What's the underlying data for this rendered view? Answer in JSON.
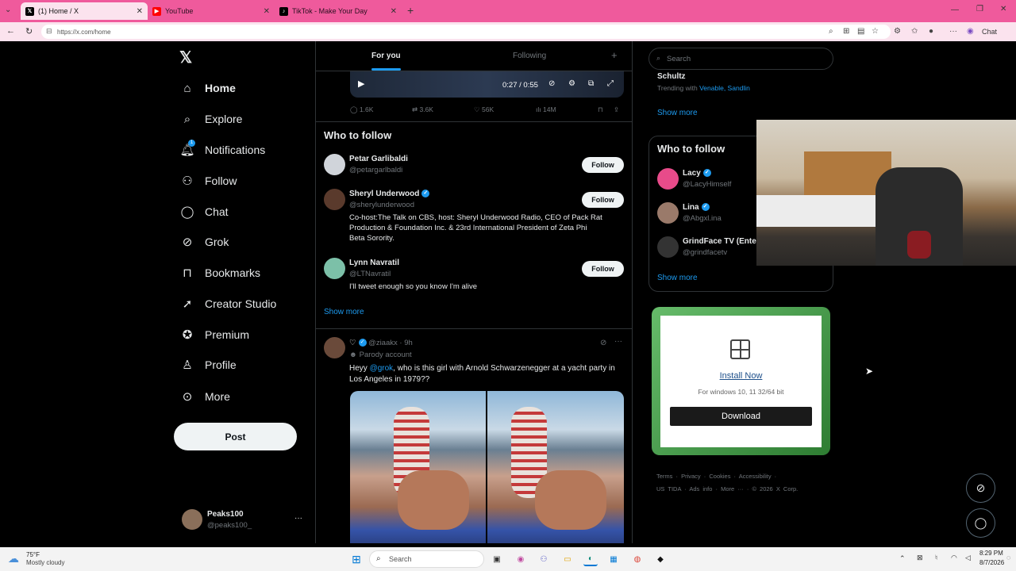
{
  "browser": {
    "tabs": [
      {
        "label": "(1) Home / X"
      },
      {
        "label": "YouTube"
      },
      {
        "label": "TikTok - Make Your Day"
      }
    ],
    "url": "https://x.com/home",
    "chat_label": "Chat"
  },
  "nav": {
    "items": [
      {
        "label": "Home",
        "icon": "home-icon"
      },
      {
        "label": "Explore",
        "icon": "search-icon"
      },
      {
        "label": "Notifications",
        "icon": "bell-icon"
      },
      {
        "label": "Follow",
        "icon": "add-person-icon"
      },
      {
        "label": "Chat",
        "icon": "chat-bubble-icon"
      },
      {
        "label": "Grok",
        "icon": "grok-icon"
      },
      {
        "label": "Bookmarks",
        "icon": "bookmark-icon"
      },
      {
        "label": "Creator Studio",
        "icon": "rocket-icon"
      },
      {
        "label": "Premium",
        "icon": "verified-badge-icon"
      },
      {
        "label": "Profile",
        "icon": "person-icon"
      },
      {
        "label": "More",
        "icon": "more-circle-icon"
      }
    ],
    "notifications_badge": "1",
    "post_label": "Post",
    "account": {
      "name": "Peaks100",
      "handle": "@peaks100_",
      "menu": "···"
    }
  },
  "feed": {
    "tabs": {
      "for_you": "For you",
      "following": "Following",
      "plus": "+"
    },
    "video": {
      "time": "0:27 / 0:55"
    },
    "stats": {
      "replies": "1.6K",
      "reposts": "3.6K",
      "likes": "56K",
      "views": "14M"
    },
    "who_to_follow": {
      "title": "Who to follow",
      "follow_label": "Follow",
      "show_more": "Show more",
      "accounts": [
        {
          "name": "Petar Garlibaldi",
          "handle": "@petargarlbaldi",
          "bio": ""
        },
        {
          "name": "Sheryl Underwood",
          "handle": "@sherylunderwood",
          "bio_lines": [
            "Co-host:The Talk on CBS, host: Sheryl Underwood Radio, CEO of Pack Rat",
            "Production & Foundation Inc. & 23rd International President of Zeta Phi",
            "Beta Sorority."
          ]
        },
        {
          "name": "Lynn Navratil",
          "handle": "@LTNavratil",
          "bio": "I'll tweet enough so you know I'm alive"
        }
      ]
    },
    "post": {
      "name": "♡",
      "handle": "@ziaakx",
      "time": "· 9h",
      "label": "Parody account",
      "text_prefix": "Heyy ",
      "mention": "@grok",
      "text_rest": ", who is this girl with Arnold Schwarzenegger at a yacht party in",
      "text_line2": "Los Angeles in 1979??"
    }
  },
  "right": {
    "search_placeholder": "Search",
    "trend": {
      "title": "Schultz",
      "trending_with": "Trending with",
      "tags": "Venable, Sandlin"
    },
    "show_more": "Show more",
    "who_to_follow": {
      "title": "Who to follow",
      "accounts": [
        {
          "name": "Lacy",
          "handle": "@LacyHimself"
        },
        {
          "name": "Lina",
          "handle": "@Abgxl.ina"
        },
        {
          "name": "GrindFace TV (Ente",
          "handle": "@grindfacetv"
        }
      ],
      "show_more": "Show more"
    },
    "ad": {
      "install": "Install Now",
      "subtitle": "For windows 10, 11 32/64 bit",
      "download": "Download"
    },
    "footer": {
      "line1": [
        "Terms",
        "Privacy",
        "Cookies",
        "Accessibility"
      ],
      "line2": [
        "US TIDA",
        "Ads info",
        "More ···",
        "© 2026 X Corp."
      ]
    }
  },
  "taskbar": {
    "weather_temp": "75°F",
    "weather_desc": "Mostly cloudy",
    "search": "Search",
    "time": "8:29 PM",
    "date": "8/7/2026"
  },
  "colors": {
    "accent": "#1d9bf0",
    "tabbar": "#ef5a9c",
    "ad_border": "#4caf50"
  }
}
